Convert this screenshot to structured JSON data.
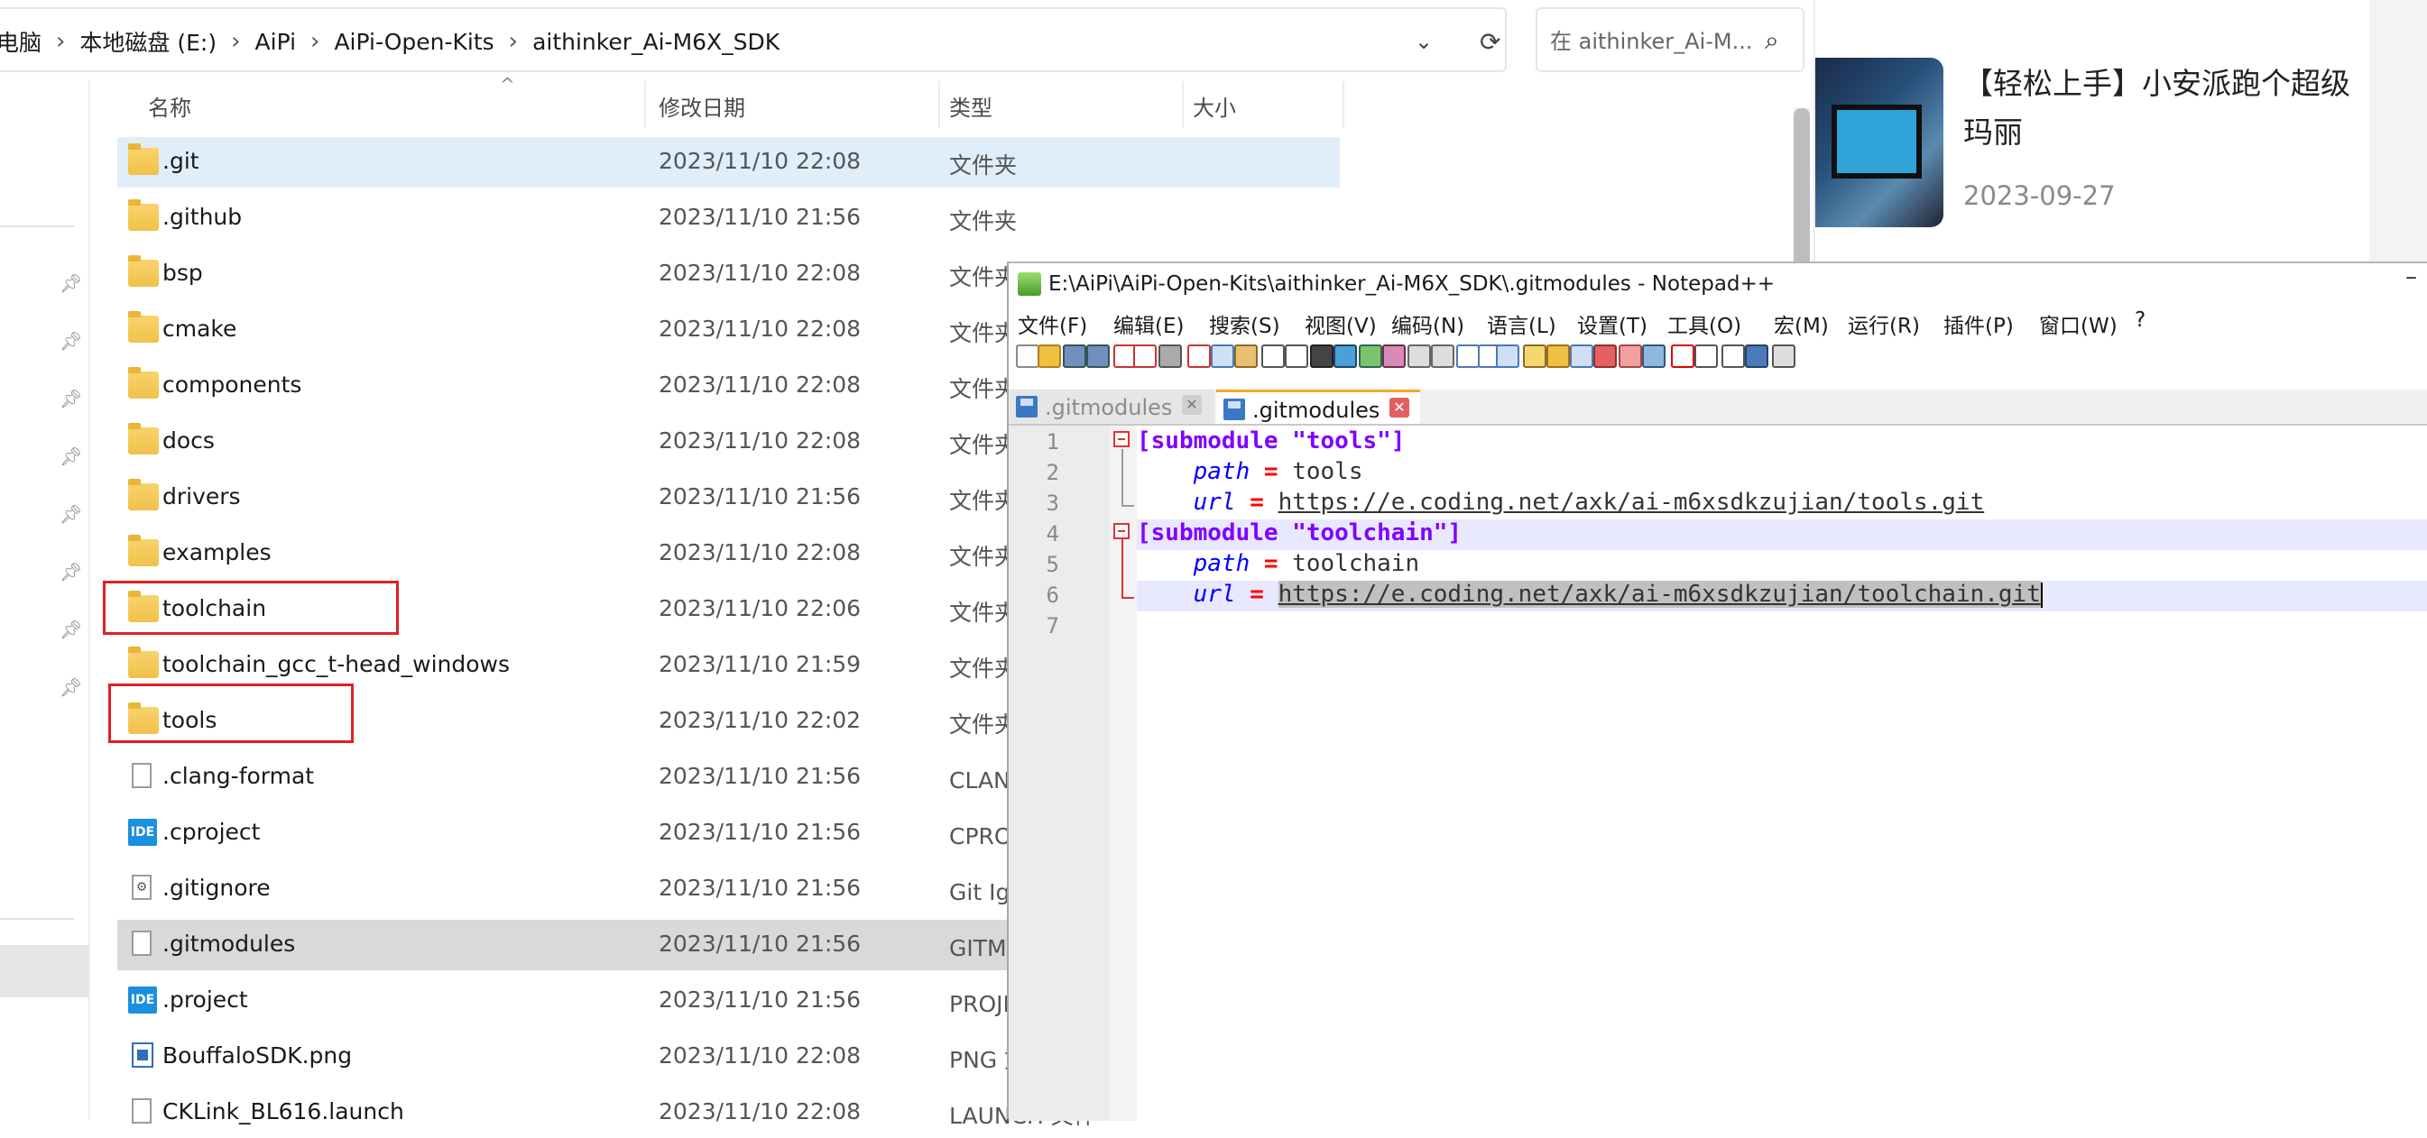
{
  "explorer": {
    "breadcrumb": [
      "电脑",
      "本地磁盘 (E:)",
      "AiPi",
      "AiPi-Open-Kits",
      "aithinker_Ai-M6X_SDK"
    ],
    "search_placeholder": "在 aithinker_Ai-M...",
    "columns": {
      "name": "名称",
      "date": "修改日期",
      "type": "类型",
      "size": "大小"
    },
    "files": [
      {
        "name": ".git",
        "date": "2023/11/10 22:08",
        "type": "文件夹",
        "icon": "folder-icon"
      },
      {
        "name": ".github",
        "date": "2023/11/10 21:56",
        "type": "文件夹",
        "icon": "folder-icon"
      },
      {
        "name": "bsp",
        "date": "2023/11/10 22:08",
        "type": "文件夹",
        "icon": "folder-icon"
      },
      {
        "name": "cmake",
        "date": "2023/11/10 22:08",
        "type": "文件夹",
        "icon": "folder-icon"
      },
      {
        "name": "components",
        "date": "2023/11/10 22:08",
        "type": "文件夹",
        "icon": "folder-icon"
      },
      {
        "name": "docs",
        "date": "2023/11/10 22:08",
        "type": "文件夹",
        "icon": "folder-icon"
      },
      {
        "name": "drivers",
        "date": "2023/11/10 21:56",
        "type": "文件夹",
        "icon": "folder-icon"
      },
      {
        "name": "examples",
        "date": "2023/11/10 22:08",
        "type": "文件夹",
        "icon": "folder-icon"
      },
      {
        "name": "toolchain",
        "date": "2023/11/10 22:06",
        "type": "文件夹",
        "icon": "folder-icon"
      },
      {
        "name": "toolchain_gcc_t-head_windows",
        "date": "2023/11/10 21:59",
        "type": "文件夹",
        "icon": "folder-icon"
      },
      {
        "name": "tools",
        "date": "2023/11/10 22:02",
        "type": "文件夹",
        "icon": "folder-icon"
      },
      {
        "name": ".clang-format",
        "date": "2023/11/10 21:56",
        "type": "CLANG-FORMAT 文件",
        "icon": "file-icon"
      },
      {
        "name": ".cproject",
        "date": "2023/11/10 21:56",
        "type": "CPROJECT 文件",
        "icon": "ide-icon"
      },
      {
        "name": ".gitignore",
        "date": "2023/11/10 21:56",
        "type": "Git Ignore 源文件",
        "icon": "gear-file-icon"
      },
      {
        "name": ".gitmodules",
        "date": "2023/11/10 21:56",
        "type": "GITMODULES 文件",
        "icon": "file-icon"
      },
      {
        "name": ".project",
        "date": "2023/11/10 21:56",
        "type": "PROJECT 文件",
        "icon": "ide-icon"
      },
      {
        "name": "BouffaloSDK.png",
        "date": "2023/11/10 22:08",
        "type": "PNG 文件",
        "icon": "png-icon"
      },
      {
        "name": "CKLink_BL616.launch",
        "date": "2023/11/10 22:08",
        "type": "LAUNCH 文件",
        "icon": "file-icon"
      }
    ]
  },
  "article": {
    "title": "【轻松上手】小安派跑个超级玛丽",
    "date": "2023-09-27"
  },
  "notepad": {
    "title": "E:\\AiPi\\AiPi-Open-Kits\\aithinker_Ai-M6X_SDK\\.gitmodules - Notepad++",
    "menu": [
      "文件(F)",
      "编辑(E)",
      "搜索(S)",
      "视图(V)",
      "编码(N)",
      "语言(L)",
      "设置(T)",
      "工具(O)",
      "宏(M)",
      "运行(R)",
      "插件(P)",
      "窗口(W)",
      "?"
    ],
    "tabs": [
      ".gitmodules",
      ".gitmodules"
    ],
    "lines": [
      {
        "n": "1",
        "section": "[submodule \"tools\"]"
      },
      {
        "n": "2",
        "key": "path",
        "op": "=",
        "value": "tools"
      },
      {
        "n": "3",
        "key": "url",
        "op": "=",
        "value": "https://e.coding.net/axk/ai-m6xsdkzujian/tools.git"
      },
      {
        "n": "4",
        "section": "[submodule \"toolchain\"]"
      },
      {
        "n": "5",
        "key": "path",
        "op": "=",
        "value": "toolchain"
      },
      {
        "n": "6",
        "key": "url",
        "op": "=",
        "value": "https://e.coding.net/axk/ai-m6xsdkzujian/toolchain.git"
      },
      {
        "n": "7"
      }
    ]
  }
}
